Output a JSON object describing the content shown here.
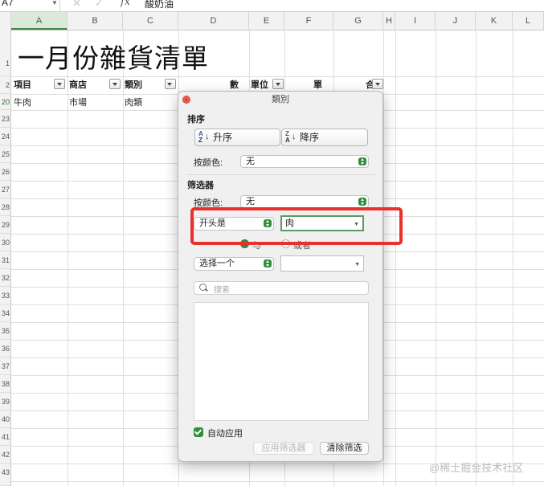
{
  "formula_bar": {
    "name_box": "A7",
    "cancel_icon": "✕",
    "confirm_icon": "✓",
    "fx_label": "fx",
    "value": "酸奶油"
  },
  "columns": [
    "A",
    "B",
    "C",
    "D",
    "E",
    "F",
    "G",
    "H",
    "I",
    "J",
    "K",
    "L"
  ],
  "rows": [
    "1",
    "2",
    "20",
    "23",
    "24",
    "25",
    "26",
    "27",
    "28",
    "29",
    "30",
    "31",
    "32",
    "33",
    "34",
    "35",
    "36",
    "37",
    "38",
    "39",
    "40",
    "41",
    "42",
    "43"
  ],
  "sheet": {
    "title": "一月份雜貨清單",
    "headers": {
      "a": "項目",
      "b": "商店",
      "c": "類別",
      "d": "數",
      "e": "單位",
      "f": "單",
      "g": "合"
    },
    "row20": {
      "a": "牛肉",
      "b": "市場",
      "c": "肉類"
    }
  },
  "dialog": {
    "title": "類別",
    "sort": {
      "heading": "排序",
      "asc_label": "升序",
      "desc_label": "降序",
      "glyph_top_asc": "A",
      "glyph_bottom_asc": "Z",
      "glyph_top_desc": "Z",
      "glyph_bottom_desc": "A",
      "arrow": "↓",
      "color_label": "按颜色:",
      "color_value": "无"
    },
    "filter": {
      "heading": "筛选器",
      "color_label": "按颜色:",
      "color_value": "无",
      "cond1_op": "开头是",
      "cond1_value": "肉",
      "and_label": "与",
      "or_label": "或者",
      "cond2_op": "选择一个",
      "cond2_value": "",
      "search_placeholder": "搜索"
    },
    "auto_apply_label": "自动应用",
    "apply_button": "应用筛选器",
    "clear_button": "清除筛选",
    "accent_color": "#2f8e3a"
  },
  "annotation_color": "#e8302c",
  "watermark": "@稀土掘金技术社区"
}
